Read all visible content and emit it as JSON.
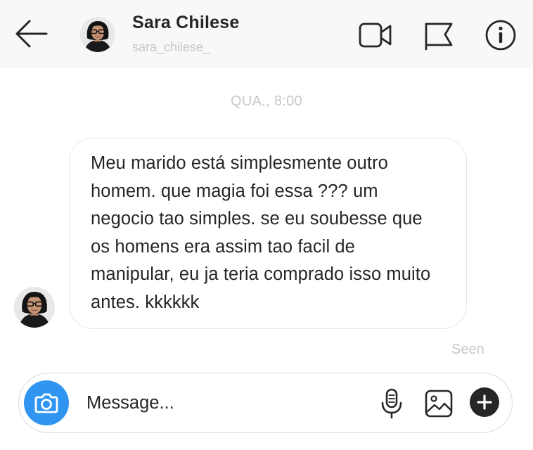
{
  "header": {
    "contact_name": "Sara Chilese",
    "contact_handle": "sara_chilese_",
    "icons": {
      "back": "arrow-left-icon",
      "video": "video-camera-icon",
      "report": "flag-icon",
      "info": "info-icon"
    }
  },
  "conversation": {
    "timestamp": "QUA., 8:00",
    "messages": [
      {
        "sender": "Sara Chilese",
        "text": "Meu marido está simplesmente outro homem. que magia foi essa ??? um negocio tao simples. se eu soubesse que os homens era assim tao facil de manipular, eu ja teria comprado isso muito antes. kkkkkk"
      }
    ],
    "status": "Seen"
  },
  "composer": {
    "placeholder": "Message...",
    "icons": {
      "camera": "camera-icon",
      "mic": "microphone-icon",
      "gallery": "image-icon",
      "more": "plus-icon"
    }
  },
  "colors": {
    "accent_blue": "#2f95f1",
    "text_primary": "#262626",
    "text_muted": "#c7c7c7",
    "header_bg": "#f8f8f8",
    "bubble_border": "#e6e6e6"
  }
}
